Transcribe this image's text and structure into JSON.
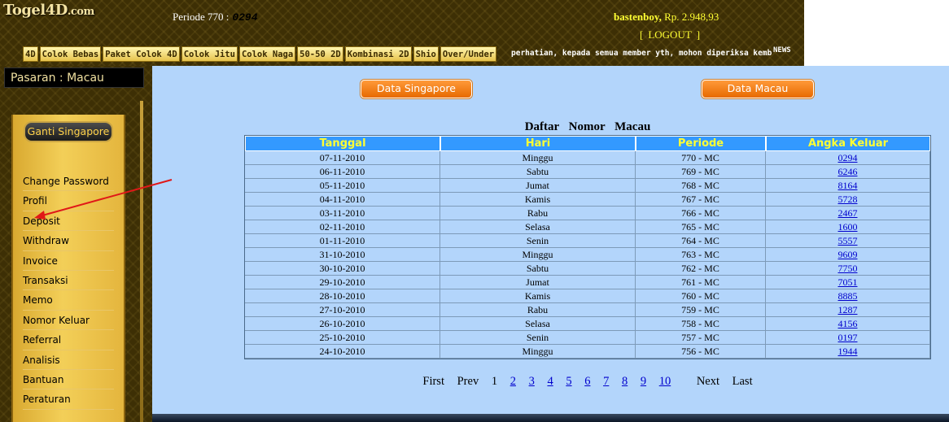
{
  "header": {
    "logo_main": "Togel4D",
    "logo_dom": ".com",
    "periode_label": "Periode  770  :",
    "periode_number": "0294",
    "username": "bastenboy,",
    "saldo": " Rp. 2.948,93",
    "logout_open": "[",
    "logout_label": "LOGOUT",
    "logout_close": "]",
    "nav": [
      "4D",
      "Colok Bebas",
      "Paket Colok 4D",
      "Colok Jitu",
      "Colok Naga",
      "50-50 2D",
      "Kombinasi 2D",
      "Shio",
      "Over/Under"
    ],
    "marquee": "perhatian, kepada semua member yth, mohon diperiksa kembali",
    "news": "NEWS"
  },
  "sidebar": {
    "pasaran": "Pasaran : Macau",
    "ganti_button": "Ganti Singapore",
    "menu": [
      "Change Password",
      "Profil",
      "Deposit",
      "Withdraw",
      "Invoice",
      "Transaksi",
      "Memo",
      "Nomor Keluar",
      "Referral",
      "Analisis",
      "Bantuan",
      "Peraturan"
    ]
  },
  "main": {
    "btn_singapore": "Data Singapore",
    "btn_macau": "Data Macau",
    "table_title": "Daftar Nomor Macau",
    "columns": [
      "Tanggal",
      "Hari",
      "Periode",
      "Angka Keluar"
    ],
    "rows": [
      [
        "07-11-2010",
        "Minggu",
        "770 - MC",
        "0294"
      ],
      [
        "06-11-2010",
        "Sabtu",
        "769 - MC",
        "6246"
      ],
      [
        "05-11-2010",
        "Jumat",
        "768 - MC",
        "8164"
      ],
      [
        "04-11-2010",
        "Kamis",
        "767 - MC",
        "5728"
      ],
      [
        "03-11-2010",
        "Rabu",
        "766 - MC",
        "2467"
      ],
      [
        "02-11-2010",
        "Selasa",
        "765 - MC",
        "1600"
      ],
      [
        "01-11-2010",
        "Senin",
        "764 - MC",
        "5557"
      ],
      [
        "31-10-2010",
        "Minggu",
        "763 - MC",
        "9609"
      ],
      [
        "30-10-2010",
        "Sabtu",
        "762 - MC",
        "7750"
      ],
      [
        "29-10-2010",
        "Jumat",
        "761 - MC",
        "7051"
      ],
      [
        "28-10-2010",
        "Kamis",
        "760 - MC",
        "8885"
      ],
      [
        "27-10-2010",
        "Rabu",
        "759 - MC",
        "1287"
      ],
      [
        "26-10-2010",
        "Selasa",
        "758 - MC",
        "4156"
      ],
      [
        "25-10-2010",
        "Senin",
        "757 - MC",
        "0197"
      ],
      [
        "24-10-2010",
        "Minggu",
        "756 - MC",
        "1944"
      ]
    ],
    "pager": {
      "first": "First",
      "prev": "Prev",
      "current": "1",
      "pages": [
        "2",
        "3",
        "4",
        "5",
        "6",
        "7",
        "8",
        "9",
        "10"
      ],
      "next": "Next",
      "last": "Last"
    }
  },
  "colors": {
    "accent_orange": "#e76a00",
    "table_header": "#3399ff",
    "header_text": "#ffff33",
    "page_bg": "#b3d5fb"
  },
  "icons": [
    "red-annotation-arrow"
  ]
}
